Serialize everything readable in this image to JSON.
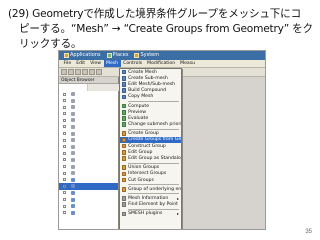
{
  "slide": {
    "title_line1": "(29) Geometryで作成した境界条件グループをメッシュ下にコ",
    "title_line2": "ピーする。“Mesh” → “Create Groups from Geometry” をク",
    "title_line3": "リックする。",
    "page_number": "35"
  },
  "window": {
    "taskbar": [
      "Applications",
      "Places",
      "System"
    ]
  },
  "menubar": [
    "File",
    "Edit",
    "View",
    "Mesh",
    "Controls",
    "Modification",
    "Measu"
  ],
  "object_browser": {
    "title": "Object Browser"
  },
  "mesh_menu": {
    "items": [
      {
        "label": "Create Mesh",
        "icon": "create-mesh-icon",
        "color": "blue"
      },
      {
        "label": "Create Sub-mesh",
        "icon": "create-submesh-icon",
        "color": "blue"
      },
      {
        "label": "Edit Mesh/Sub-mesh",
        "icon": "edit-mesh-icon",
        "color": "blue"
      },
      {
        "label": "Build Compound",
        "icon": "build-compound-icon",
        "color": "blue"
      },
      {
        "label": "Copy Mesh",
        "icon": "copy-mesh-icon",
        "color": "blue"
      },
      {
        "sep": true
      },
      {
        "label": "Compute",
        "icon": "compute-icon",
        "color": "green"
      },
      {
        "label": "Preview",
        "icon": "preview-icon",
        "color": "green"
      },
      {
        "label": "Evaluate",
        "icon": "evaluate-icon",
        "color": "green"
      },
      {
        "label": "Change submesh priority",
        "icon": "priority-icon",
        "color": "green"
      },
      {
        "sep": true
      },
      {
        "label": "Create Group",
        "icon": "create-group-icon",
        "color": "orange"
      },
      {
        "label": "Create Groups from Geometry",
        "icon": "groups-from-geometry-icon",
        "color": "orange",
        "highlighted": true
      },
      {
        "label": "Construct Group",
        "icon": "construct-group-icon",
        "color": "orange"
      },
      {
        "label": "Edit Group",
        "icon": "edit-group-icon",
        "color": "orange"
      },
      {
        "label": "Edit Group as Standalone",
        "icon": "edit-standalone-icon",
        "color": "orange"
      },
      {
        "sep": true
      },
      {
        "label": "Union Groups",
        "icon": "union-groups-icon",
        "color": "orange"
      },
      {
        "label": "Intersect Groups",
        "icon": "intersect-groups-icon",
        "color": "orange"
      },
      {
        "label": "Cut Groups",
        "icon": "cut-groups-icon",
        "color": "orange"
      },
      {
        "sep": true
      },
      {
        "label": "Group of underlying entities",
        "icon": "underlying-group-icon",
        "color": "orange"
      },
      {
        "sep": true
      },
      {
        "label": "Mesh Information",
        "icon": "mesh-info-icon",
        "color": "gray",
        "submenu": true
      },
      {
        "label": "Find Element by Point",
        "icon": "find-element-icon",
        "color": "gray"
      },
      {
        "sep": true
      },
      {
        "label": "SMESH plugins",
        "icon": "plugins-icon",
        "color": "gray",
        "submenu": true
      }
    ]
  }
}
